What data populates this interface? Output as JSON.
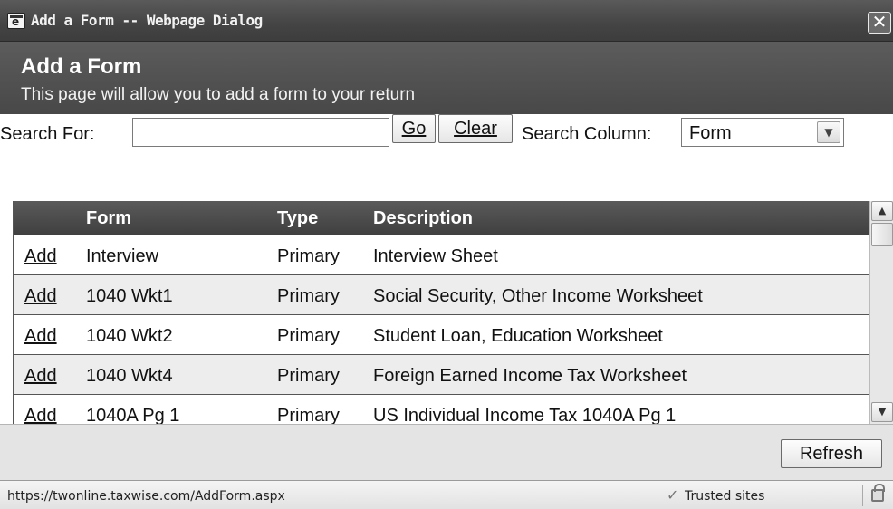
{
  "window": {
    "title": "Add a Form -- Webpage Dialog",
    "close_glyph": "✕"
  },
  "header": {
    "title": "Add a Form",
    "subtitle": "This page will allow you to add a form to your return"
  },
  "search": {
    "label": "Search For:",
    "value": "",
    "go_label": "Go",
    "clear_label": "Clear",
    "column_label": "Search Column:",
    "column_value": "Form"
  },
  "grid": {
    "columns": [
      "",
      "Form",
      "Type",
      "Description"
    ],
    "rows": [
      {
        "action": "Add",
        "form": "Interview",
        "type": "Primary",
        "description": "Interview Sheet"
      },
      {
        "action": "Add",
        "form": "1040 Wkt1",
        "type": "Primary",
        "description": "Social Security, Other Income Worksheet"
      },
      {
        "action": "Add",
        "form": "1040 Wkt2",
        "type": "Primary",
        "description": "Student Loan, Education Worksheet"
      },
      {
        "action": "Add",
        "form": "1040 Wkt4",
        "type": "Primary",
        "description": "Foreign Earned Income Tax Worksheet"
      },
      {
        "action": "Add",
        "form": "1040A Pg 1",
        "type": "Primary",
        "description": "US Individual Income Tax 1040A Pg 1"
      }
    ]
  },
  "footer": {
    "refresh_label": "Refresh"
  },
  "status": {
    "url": "https://twonline.taxwise.com/AddForm.aspx",
    "zone": "Trusted sites"
  }
}
